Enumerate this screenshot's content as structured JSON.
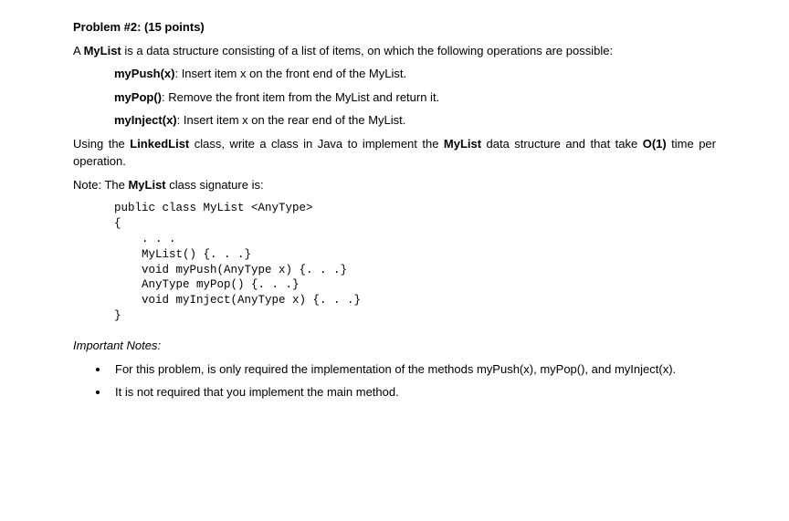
{
  "heading": "Problem #2: (15 points)",
  "intro": {
    "pre": "A ",
    "bold": "MyList",
    "post": " is a data structure consisting of a list of items, on which the following operations are possible:"
  },
  "ops": [
    {
      "name": "myPush(x)",
      "desc": ": Insert item x on the front end of the MyList."
    },
    {
      "name": "myPop()",
      "desc": ": Remove the front item from the MyList and return it."
    },
    {
      "name": "myInject(x)",
      "desc": ": Insert item x on the rear end of the MyList."
    }
  ],
  "using": {
    "pre": "Using the ",
    "b1": "LinkedList",
    "mid": " class, write a class in Java to implement the ",
    "b2": "MyList",
    "post1": " data structure and that take ",
    "b3": "O(1)",
    "post2": " time per operation."
  },
  "note": {
    "pre": "Note: The ",
    "b": "MyList",
    "post": " class signature is:"
  },
  "code": "public class MyList <AnyType>\n{\n    . . .\n    MyList() {. . .}\n    void myPush(AnyType x) {. . .}\n    AnyType myPop() {. . .}\n    void myInject(AnyType x) {. . .}\n}",
  "notesHeading": "Important Notes:",
  "bullets": [
    "For this problem, is only required the implementation of the methods myPush(x), myPop(), and myInject(x).",
    "It is not required that you implement the main method."
  ]
}
